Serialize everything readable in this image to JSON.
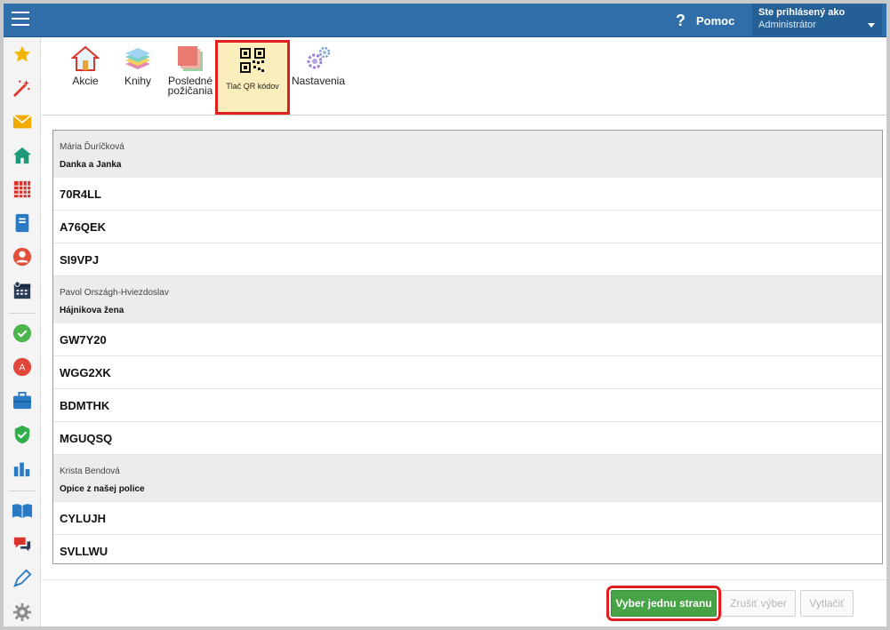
{
  "header": {
    "help_label": "Pomoc",
    "help_icon": "help-question-icon",
    "user_line1": "Ste prihlásený ako",
    "user_line2": "Administrátor",
    "bar_color": "#2f6ea8"
  },
  "sidebar": {
    "icons": [
      "star-icon",
      "magic-wand-icon",
      "envelope-icon",
      "home-icon",
      "calendar-grid-icon",
      "notebook-icon",
      "user-circle-icon",
      "schedule-icon",
      "check-badge-icon",
      "grade-icon",
      "briefcase-icon",
      "shield-icon",
      "bar-chart-icon",
      "open-book-icon",
      "chat-icon",
      "pen-icon",
      "gear-icon"
    ]
  },
  "toolbar": {
    "tools": [
      {
        "label": "Akcie",
        "icon": "house-icon"
      },
      {
        "label": "Knihy",
        "icon": "books-stack-icon"
      },
      {
        "label_l1": "Posledné",
        "label_l2": "požičania",
        "icon": "layers-icon"
      },
      {
        "label": "Tlač QR kódov",
        "icon": "qr-code-icon",
        "active": true
      },
      {
        "label": "Nastavenia",
        "icon": "gears-icon"
      }
    ]
  },
  "table": {
    "groups": [
      {
        "author": "Mária Ďuríčková",
        "title": "Danka a Janka",
        "codes": [
          "70R4LL",
          "A76QEK",
          "SI9VPJ"
        ]
      },
      {
        "author": "Pavol Országh-Hviezdoslav",
        "title": "Hájnikova žena",
        "codes": [
          "GW7Y20",
          "WGG2XK",
          "BDMTHK",
          "MGUQSQ"
        ]
      },
      {
        "author": "Krista Bendová",
        "title": "Opice z našej police",
        "codes": [
          "CYLUJH",
          "SVLLWU"
        ]
      }
    ]
  },
  "actions": {
    "select_page": "Vyber jednu stranu",
    "cancel_selection": "Zrušiť výber",
    "print": "Vytlačiť"
  },
  "colors": {
    "primary_button": "#46a346",
    "highlight": "#e01e1e",
    "active_tool_bg": "#fbeebd"
  }
}
